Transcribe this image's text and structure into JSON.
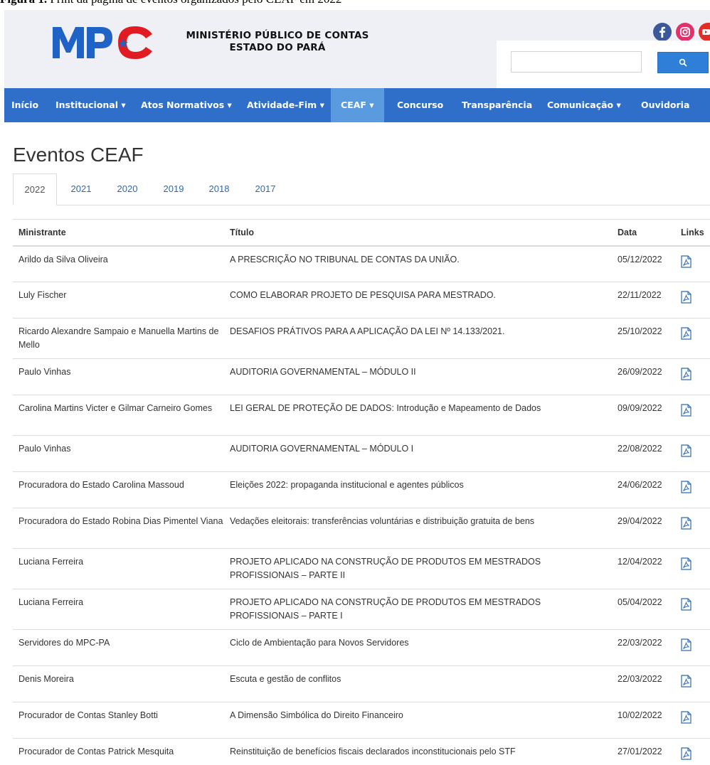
{
  "caption": {
    "prefix": "Figura 1.",
    "text": "Print da página de eventos organizados pelo CEAF em 2022"
  },
  "brand": {
    "logo_text": "MPC",
    "org_line1": "MINISTÉRIO PÚBLICO DE CONTAS",
    "org_line2": "ESTADO DO PARÁ",
    "colors": {
      "logo_blue": "#1f63c6",
      "logo_red": "#e21b23",
      "nav": "#2f6fca",
      "nav_active": "#5a9be0"
    }
  },
  "social": [
    "facebook-icon",
    "instagram-icon",
    "youtube-icon"
  ],
  "search": {
    "placeholder": "",
    "value": "",
    "button_icon": "search-icon"
  },
  "nav": {
    "items": [
      {
        "label": "Início"
      },
      {
        "label": "Institucional ▾"
      },
      {
        "label": "Atos Normativos ▾"
      },
      {
        "label": "Atividade-Fim ▾"
      },
      {
        "label": "CEAF ▾",
        "active": true
      },
      {
        "label": "Concurso"
      },
      {
        "label": "Transparência"
      },
      {
        "label": "Comunicação ▾"
      },
      {
        "label": "Ouvidoria"
      }
    ]
  },
  "page": {
    "title": "Eventos CEAF"
  },
  "tabs": [
    {
      "label": "2022",
      "active": true
    },
    {
      "label": "2021"
    },
    {
      "label": "2020"
    },
    {
      "label": "2019"
    },
    {
      "label": "2018"
    },
    {
      "label": "2017"
    }
  ],
  "table": {
    "headers": {
      "ministrante": "Ministrante",
      "titulo": "Título",
      "data": "Data",
      "links": "Links"
    },
    "rows": [
      {
        "ministrante": "Arildo da Silva Oliveira",
        "titulo": "A PRESCRIÇÃO NO TRIBUNAL DE CONTAS DA UNIÃO.",
        "data": "05/12/2022"
      },
      {
        "ministrante": "Luly Fischer",
        "titulo": "COMO ELABORAR PROJETO DE PESQUISA PARA MESTRADO.",
        "data": "22/11/2022"
      },
      {
        "ministrante": "Ricardo Alexandre Sampaio e Manuella Martins de Mello",
        "titulo": "DESAFIOS PRÁTIVOS PARA A APLICAÇÃO DA LEI Nº 14.133/2021.",
        "data": "25/10/2022"
      },
      {
        "ministrante": "Paulo Vinhas",
        "titulo": "AUDITORIA GOVERNAMENTAL – MÓDULO II",
        "data": "26/09/2022"
      },
      {
        "ministrante": "Carolina Martins Victer e Gilmar Carneiro Gomes",
        "titulo": "LEI GERAL DE PROTEÇÃO DE DADOS: Introdução e Mapeamento de Dados",
        "data": "09/09/2022"
      },
      {
        "ministrante": "Paulo Vinhas",
        "titulo": "AUDITORIA GOVERNAMENTAL – MÓDULO I",
        "data": "22/08/2022"
      },
      {
        "ministrante": "Procuradora do Estado Carolina Massoud",
        "titulo": "Eleições 2022: propaganda institucional e agentes públicos",
        "data": "24/06/2022"
      },
      {
        "ministrante": "Procuradora do Estado Robina Dias Pimentel Viana",
        "titulo": "Vedações eleitorais: transferências voluntárias e distribuição gratuita de bens",
        "data": "29/04/2022"
      },
      {
        "ministrante": "Luciana Ferreira",
        "titulo": "PROJETO APLICADO NA CONSTRUÇÃO DE PRODUTOS EM MESTRADOS PROFISSIONAIS – PARTE II",
        "data": "12/04/2022"
      },
      {
        "ministrante": "Luciana Ferreira",
        "titulo": "PROJETO APLICADO NA CONSTRUÇÃO DE PRODUTOS EM MESTRADOS PROFISSIONAIS – PARTE I",
        "data": "05/04/2022"
      },
      {
        "ministrante": "Servidores do MPC-PA",
        "titulo": "Ciclo de Ambientação para Novos Servidores",
        "data": "22/03/2022"
      },
      {
        "ministrante": "Denis Moreira",
        "titulo": "Escuta e gestão de conflitos",
        "data": "22/03/2022"
      },
      {
        "ministrante": "Procurador de Contas Stanley Botti",
        "titulo": "A Dimensão Simbólica do Direito Financeiro",
        "data": "10/02/2022"
      },
      {
        "ministrante": "Procurador de Contas Patrick Mesquita",
        "titulo": "Reinstituição de benefícios fiscais declarados inconstitucionais pelo STF",
        "data": "27/01/2022"
      }
    ]
  }
}
